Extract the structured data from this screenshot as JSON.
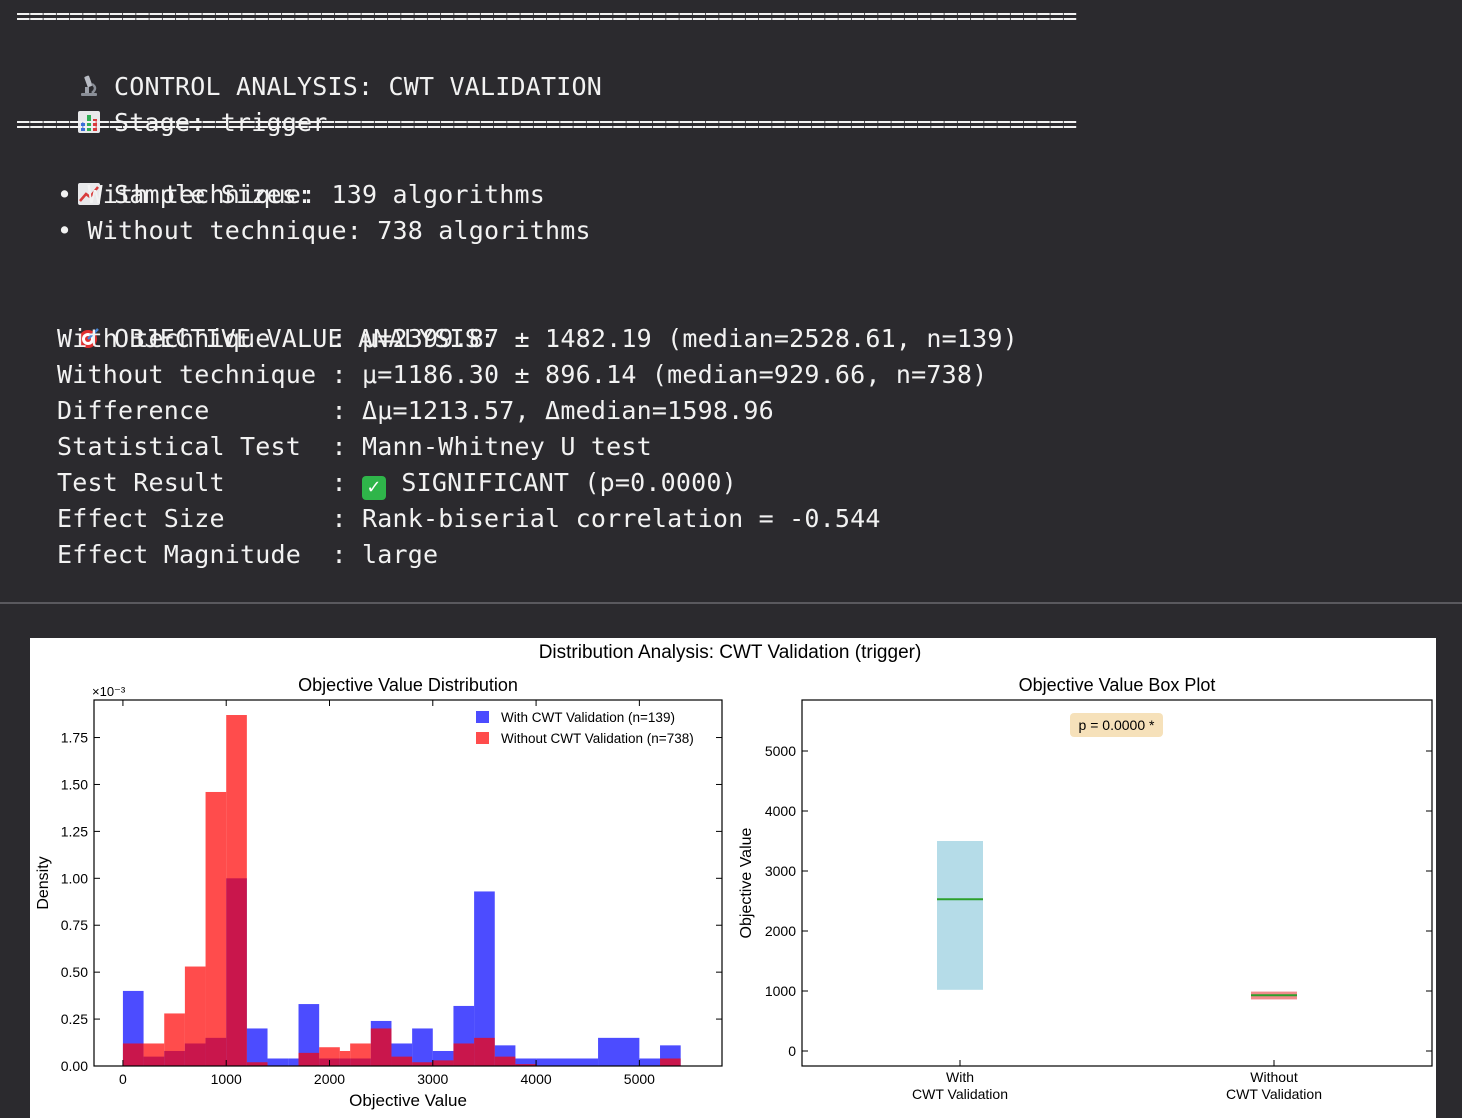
{
  "terminal": {
    "separator": "================================================================================",
    "header_title": "CONTROL ANALYSIS: CWT VALIDATION",
    "header_stage": "Stage: trigger",
    "sample_title": "Sample Sizes:",
    "sample_with": "• With technique: 139 algorithms",
    "sample_without": "• Without technique: 738 algorithms",
    "objective_title": "OBJECTIVE VALUE ANALYSIS:",
    "rows": [
      {
        "label": "With technique    ",
        "value": "μ=2399.87 ± 1482.19 (median=2528.61, n=139)"
      },
      {
        "label": "Without technique ",
        "value": "μ=1186.30 ± 896.14 (median=929.66, n=738)"
      },
      {
        "label": "Difference        ",
        "value": "Δμ=1213.57, Δmedian=1598.96"
      },
      {
        "label": "Statistical Test  ",
        "value": "Mann-Whitney U test"
      },
      {
        "label": "Test Result       ",
        "value": "SIGNIFICANT (p=0.0000)"
      },
      {
        "label": "Effect Size       ",
        "value": "Rank-biserial correlation = -0.544"
      },
      {
        "label": "Effect Magnitude  ",
        "value": "large"
      }
    ],
    "icons": [
      "microscope-icon",
      "bar-chart-icon",
      "chart-increasing-icon",
      "target-icon",
      "check-mark-icon"
    ]
  },
  "figure": {
    "suptitle": "Distribution Analysis: CWT Validation (trigger)"
  },
  "chart_data": [
    {
      "type": "bar",
      "title": "Objective Value Distribution",
      "xlabel": "Objective Value",
      "ylabel": "Density",
      "y_multiplier_label": "×10⁻³",
      "xlim": [
        -280,
        5800
      ],
      "ylim": [
        0,
        1.95
      ],
      "x_ticks": [
        "0",
        "1000",
        "2000",
        "3000",
        "4000",
        "5000"
      ],
      "y_ticks": [
        "0.00",
        "0.25",
        "0.50",
        "0.75",
        "1.00",
        "1.25",
        "1.50",
        "1.75"
      ],
      "legend_position": "top-right",
      "series": [
        {
          "name": "With CWT Validation (n=139)",
          "color": "#0000ff",
          "alpha": 0.7,
          "bin_edges": [
            0,
            200,
            400,
            600,
            800,
            1000,
            1200,
            1400,
            1600,
            1700,
            1900,
            2100,
            2200,
            2400,
            2600,
            2800,
            3000,
            3200,
            3400,
            3600,
            3800,
            4000,
            4600,
            5000,
            5200,
            5400
          ],
          "values": [
            0.4,
            0.05,
            0.08,
            0.12,
            0.15,
            1.0,
            0.2,
            0.04,
            0.04,
            0.33,
            0.04,
            0.04,
            0.04,
            0.24,
            0.12,
            0.2,
            0.08,
            0.32,
            0.93,
            0.11,
            0.04,
            0.04,
            0.15,
            0.04,
            0.11,
            0.15
          ]
        },
        {
          "name": "Without CWT Validation (n=738)",
          "color": "#ff0000",
          "alpha": 0.7,
          "bin_edges": [
            0,
            200,
            400,
            600,
            800,
            1000,
            1200,
            1400,
            1600,
            1700,
            1900,
            2100,
            2200,
            2400,
            2600,
            2800,
            3000,
            3200,
            3400,
            3600,
            3800,
            4000,
            4600,
            5000,
            5200,
            5400
          ],
          "values": [
            0.12,
            0.12,
            0.28,
            0.53,
            1.46,
            1.87,
            0.02,
            0.0,
            0.0,
            0.07,
            0.1,
            0.08,
            0.12,
            0.2,
            0.05,
            0.02,
            0.03,
            0.12,
            0.15,
            0.05,
            0.01,
            0.0,
            0.0,
            0.0,
            0.04,
            0.0
          ]
        }
      ]
    },
    {
      "type": "box",
      "title": "Objective Value Box Plot",
      "ylabel": "Objective Value",
      "ylim": [
        -250,
        5850
      ],
      "y_ticks": [
        "0",
        "1000",
        "2000",
        "3000",
        "4000",
        "5000"
      ],
      "categories": [
        "With\nCWT Validation",
        "Without\nCWT Validation"
      ],
      "annotation": "p = 0.0000 *",
      "boxes": [
        {
          "q1": 1020,
          "median": 2528.61,
          "q3": 3500,
          "color": "#add8e6"
        },
        {
          "q1": 860,
          "median": 929.66,
          "q3": 990,
          "color": "#f08080"
        }
      ]
    }
  ]
}
